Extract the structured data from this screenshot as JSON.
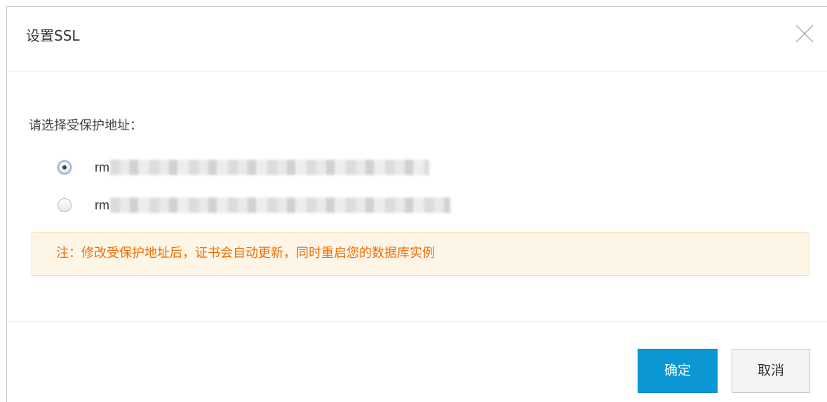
{
  "dialog": {
    "title": "设置SSL",
    "close_icon": "close-icon"
  },
  "body": {
    "label": "请选择受保护地址：",
    "options": [
      {
        "prefix": "rm",
        "checked": true
      },
      {
        "prefix": "rm",
        "checked": false
      }
    ],
    "notice": "注：修改受保护地址后，证书会自动更新，同时重启您的数据库实例"
  },
  "footer": {
    "confirm_label": "确定",
    "cancel_label": "取消"
  },
  "colors": {
    "primary": "#0b97d4",
    "notice_text": "#f26c00",
    "notice_bg": "#fdf6e6"
  }
}
